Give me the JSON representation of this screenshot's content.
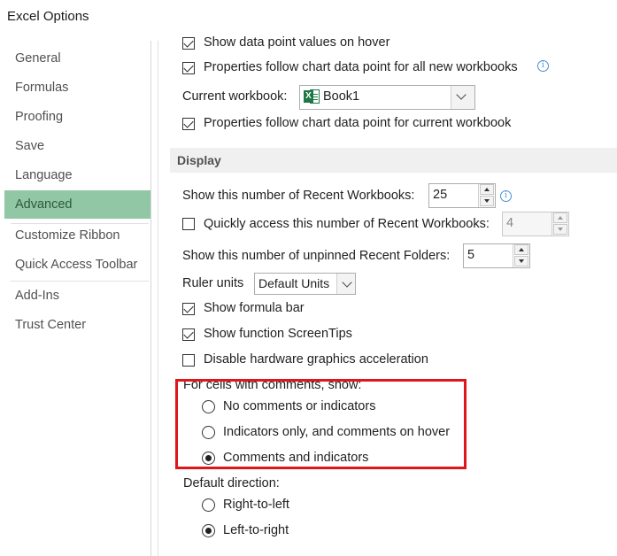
{
  "window": {
    "title": "Excel Options"
  },
  "sidebar": {
    "items": [
      {
        "label": "General"
      },
      {
        "label": "Formulas"
      },
      {
        "label": "Proofing"
      },
      {
        "label": "Save"
      },
      {
        "label": "Language"
      },
      {
        "label": "Advanced"
      },
      {
        "label": "Customize Ribbon"
      },
      {
        "label": "Quick Access Toolbar"
      },
      {
        "label": "Add-Ins"
      },
      {
        "label": "Trust Center"
      }
    ],
    "active": "Advanced"
  },
  "chart_options": {
    "show_values_hover": {
      "label": "Show data point values on hover",
      "checked": true
    },
    "properties_all": {
      "label": "Properties follow chart data point for all new workbooks",
      "checked": true
    },
    "current_workbook_label": "Current workbook:",
    "current_workbook_value": "Book1",
    "properties_current": {
      "label": "Properties follow chart data point for current workbook",
      "checked": true
    }
  },
  "display": {
    "header": "Display",
    "recent_workbooks_label": "Show this number of Recent Workbooks:",
    "recent_workbooks_value": "25",
    "quick_access": {
      "label": "Quickly access this number of Recent Workbooks:",
      "checked": false
    },
    "quick_access_value": "4",
    "recent_folders_label": "Show this number of unpinned Recent Folders:",
    "recent_folders_value": "5",
    "ruler_units_label": "Ruler units",
    "ruler_units_value": "Default Units",
    "formula_bar": {
      "label": "Show formula bar",
      "checked": true
    },
    "screen_tips": {
      "label": "Show function ScreenTips",
      "checked": true
    },
    "disable_hw": {
      "label": "Disable hardware graphics acceleration",
      "checked": false
    },
    "comments_label": "For cells with comments, show:",
    "comment_options": [
      {
        "label": "No comments or indicators",
        "checked": false
      },
      {
        "label": "Indicators only, and comments on hover",
        "checked": false
      },
      {
        "label": "Comments and indicators",
        "checked": true
      }
    ],
    "direction_label": "Default direction:",
    "direction_options": [
      {
        "label": "Right-to-left",
        "checked": false
      },
      {
        "label": "Left-to-right",
        "checked": true
      }
    ]
  },
  "colors": {
    "active_nav": "#91c7a4",
    "highlight_box": "#e0161d",
    "excel_green": "#1d7845",
    "info_blue": "#4a8fd6"
  },
  "icons": [
    "info-icon",
    "excel-workbook-icon",
    "dropdown-arrow-icon",
    "spin-up-icon",
    "spin-down-icon"
  ]
}
